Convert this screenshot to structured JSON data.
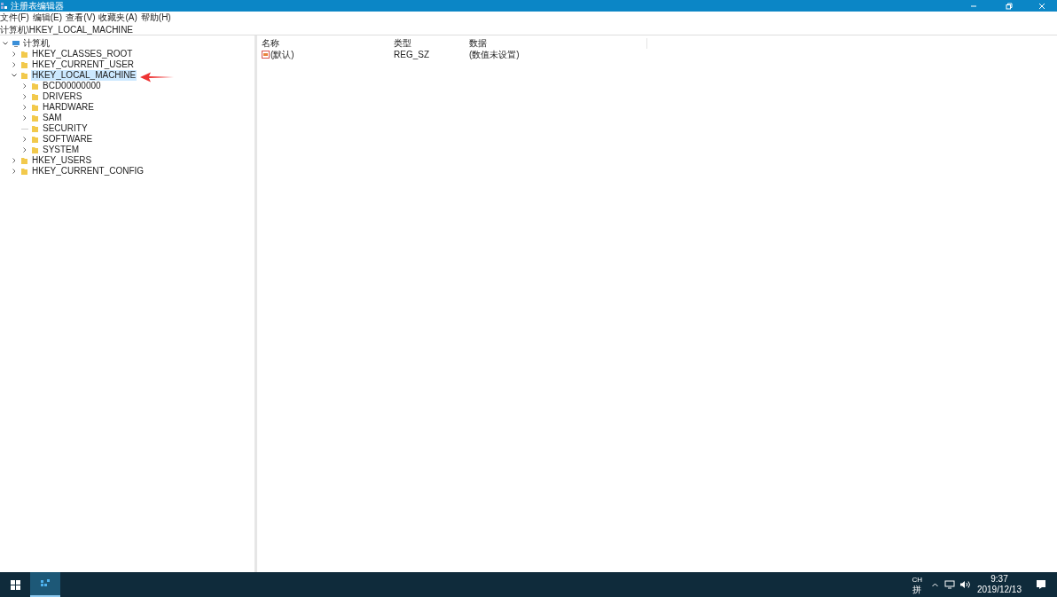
{
  "window": {
    "title": "注册表编辑器"
  },
  "menu": [
    "文件(F)",
    "编辑(E)",
    "查看(V)",
    "收藏夹(A)",
    "帮助(H)"
  ],
  "address": "计算机\\HKEY_LOCAL_MACHINE",
  "tree": {
    "label": "计算机",
    "expanded": true,
    "children": [
      {
        "label": "HKEY_CLASSES_ROOT",
        "kind": "branch",
        "expanded": false,
        "selected": false
      },
      {
        "label": "HKEY_CURRENT_USER",
        "kind": "branch",
        "expanded": false,
        "selected": false
      },
      {
        "label": "HKEY_LOCAL_MACHINE",
        "kind": "branch",
        "expanded": true,
        "selected": true,
        "children": [
          {
            "label": "BCD00000000",
            "kind": "branch",
            "expanded": false,
            "selected": false
          },
          {
            "label": "DRIVERS",
            "kind": "branch",
            "expanded": false,
            "selected": false
          },
          {
            "label": "HARDWARE",
            "kind": "branch",
            "expanded": false,
            "selected": false
          },
          {
            "label": "SAM",
            "kind": "branch",
            "expanded": false,
            "selected": false
          },
          {
            "label": "SECURITY",
            "kind": "leaf",
            "selected": false
          },
          {
            "label": "SOFTWARE",
            "kind": "branch",
            "expanded": false,
            "selected": false
          },
          {
            "label": "SYSTEM",
            "kind": "branch",
            "expanded": false,
            "selected": false
          }
        ]
      },
      {
        "label": "HKEY_USERS",
        "kind": "branch",
        "expanded": false,
        "selected": false
      },
      {
        "label": "HKEY_CURRENT_CONFIG",
        "kind": "branch",
        "expanded": false,
        "selected": false
      }
    ]
  },
  "list": {
    "columns": [
      "名称",
      "类型",
      "数据"
    ],
    "rows": [
      {
        "name": "(默认)",
        "type": "REG_SZ",
        "data": "(数值未设置)"
      }
    ]
  },
  "taskbar": {
    "ime_top": "CH",
    "ime_bottom": "拼",
    "time": "9:37",
    "date": "2019/12/13"
  }
}
